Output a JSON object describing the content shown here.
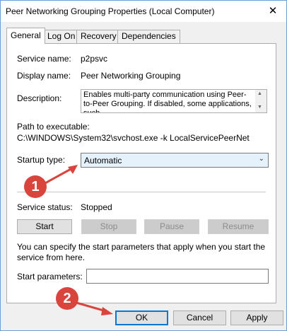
{
  "window": {
    "title": "Peer Networking Grouping Properties (Local Computer)",
    "close_glyph": "✕"
  },
  "tabs": [
    {
      "label": "General",
      "active": true
    },
    {
      "label": "Log On"
    },
    {
      "label": "Recovery"
    },
    {
      "label": "Dependencies"
    }
  ],
  "general": {
    "service_name_label": "Service name:",
    "service_name_value": "p2psvc",
    "display_name_label": "Display name:",
    "display_name_value": "Peer Networking Grouping",
    "description_label": "Description:",
    "description_value": "Enables multi-party communication using Peer-to-Peer Grouping.  If disabled, some applications, such",
    "path_label": "Path to executable:",
    "path_value": "C:\\WINDOWS\\System32\\svchost.exe -k LocalServicePeerNet",
    "startup_type_label": "Startup type:",
    "startup_type_value": "Automatic",
    "service_status_label": "Service status:",
    "service_status_value": "Stopped",
    "buttons": {
      "start": "Start",
      "stop": "Stop",
      "pause": "Pause",
      "resume": "Resume"
    },
    "start_params_note": "You can specify the start parameters that apply when you start the service from here.",
    "start_params_label": "Start parameters:",
    "start_params_value": ""
  },
  "footer": {
    "ok": "OK",
    "cancel": "Cancel",
    "apply": "Apply"
  },
  "annotations": {
    "marker_1": "1",
    "marker_2": "2",
    "color": "#d9453d"
  },
  "icons": [
    "close-icon",
    "chevron-down-icon",
    "scroll-up-icon",
    "scroll-down-icon"
  ]
}
